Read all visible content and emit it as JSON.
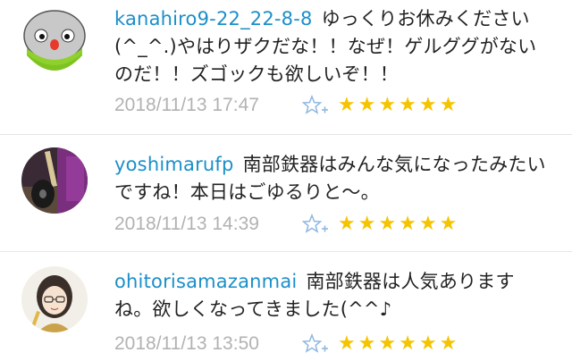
{
  "comments": [
    {
      "username": "kanahiro9-22_22-8-8",
      "text": "ゆっくりお休みください(^_^.)やはりザクだな！！なぜ！ゲルググがないのだ！！ズゴックも欲しいぞ！！",
      "timestamp": "2018/11/13 17:47",
      "star_count": 6,
      "avatar_icon": "cartoon-face-avatar"
    },
    {
      "username": "yoshimarufp",
      "text": "南部鉄器はみんな気になったみたいですね！本日はごゆるりと〜。",
      "timestamp": "2018/11/13 14:39",
      "star_count": 6,
      "avatar_icon": "guitar-photo-avatar"
    },
    {
      "username": "ohitorisamazanmai",
      "text": "南部鉄器は人気ありますね。欲しくなってきました(^^♪",
      "timestamp": "2018/11/13 13:50",
      "star_count": 6,
      "avatar_icon": "anime-girl-avatar"
    }
  ],
  "star_glyph": "★",
  "colors": {
    "username": "#1b8fc9",
    "timestamp": "#b2b2b2",
    "star": "#f5c400",
    "add_star": "#8fb7e0"
  }
}
